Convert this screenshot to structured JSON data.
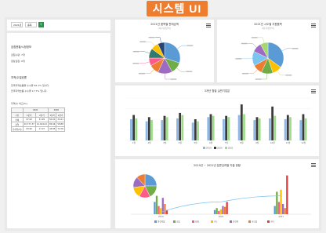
{
  "header": {
    "title": "시스템 UI"
  },
  "filters": {
    "year": "2021년",
    "type": "종목",
    "go_icon": "search-icon"
  },
  "stats": {
    "section1_title": "검침현황/시정정보",
    "line1": "검침수량: 7개",
    "line2": "정상검침: 0개",
    "section2_title": "지적/수질흐름",
    "line3": "전국지역흐름율 누수율 82.1% 입니다.",
    "line4": "전국지역흐름 누수율 17.7% 입니다.",
    "table_title": "지역/수 비교(%)",
    "table": {
      "top_headers": [
        "",
        "2021",
        "2020"
      ],
      "headers": [
        "구분",
        "1분기",
        "2분기",
        "1분기",
        "2분기"
      ],
      "rows": [
        [
          "전체",
          "67.02",
          "31.99",
          "50.01",
          "34.21"
        ],
        [
          "지역",
          "10,777.37",
          "12,344.01",
          "83.64",
          "58.88"
        ],
        [
          "전지역(비)",
          "63.62",
          "17.07",
          "44.85",
          "74.76"
        ]
      ]
    }
  },
  "chart_data": [
    {
      "type": "pie",
      "title": "2021년 품목별 판매금액",
      "subtitle": "4분기(전년비)",
      "slices": [
        {
          "value": 30,
          "color": "#5b9bd5"
        },
        {
          "value": 12,
          "color": "#70ad47"
        },
        {
          "value": 15,
          "color": "#9e6bc2"
        },
        {
          "value": 10,
          "color": "#ed7d31"
        },
        {
          "value": 8,
          "color": "#ff5b8a"
        },
        {
          "value": 10,
          "color": "#2f7c6f"
        },
        {
          "value": 8,
          "color": "#ffc000"
        },
        {
          "value": 7,
          "color": "#264478"
        }
      ]
    },
    {
      "type": "pie",
      "title": "2021년 시도별 지원품목",
      "subtitle": "4분기(전년비)",
      "slices": [
        {
          "value": 35,
          "color": "#5b9bd5"
        },
        {
          "value": 10,
          "color": "#ffc000"
        },
        {
          "value": 12,
          "color": "#70ad47"
        },
        {
          "value": 10,
          "color": "#ed7d31"
        },
        {
          "value": 15,
          "color": "#7cc4f0"
        },
        {
          "value": 10,
          "color": "#9e6bc2"
        },
        {
          "value": 8,
          "color": "#a5d86e"
        }
      ]
    },
    {
      "type": "bar",
      "title": "3개년 월별 실판기업분",
      "categories": [
        "1월",
        "2월",
        "3월",
        "4월",
        "5월",
        "6월",
        "7월",
        "8월",
        "9월",
        "10월",
        "11월",
        "12월"
      ],
      "ylim": [
        0,
        100
      ],
      "series": [
        {
          "name": "2019",
          "color": "#8fb8e6",
          "values": [
            50,
            45,
            48,
            52,
            42,
            55,
            50,
            60,
            48,
            52,
            50,
            48
          ]
        },
        {
          "name": "2020",
          "color": "#3b3b3b",
          "values": [
            60,
            55,
            58,
            65,
            50,
            62,
            58,
            85,
            55,
            80,
            60,
            62
          ]
        },
        {
          "name": "2021",
          "color": "#9fdc8a",
          "values": [
            52,
            48,
            55,
            60,
            45,
            58,
            55,
            62,
            52,
            58,
            55,
            52
          ]
        }
      ]
    },
    {
      "type": "bar",
      "title": "2019년 ~ 2021년 분류입력별 지출 현황",
      "categories": [
        "2019",
        "2020",
        "2021"
      ],
      "ylim": [
        0,
        100
      ],
      "series": [
        {
          "name": "물류비용",
          "color": "#5b9bd5",
          "values": [
            30,
            10,
            20
          ]
        },
        {
          "name": "교통",
          "color": "#70ad47",
          "values": [
            45,
            15,
            55
          ]
        },
        {
          "name": "자재",
          "color": "#ff5b8a",
          "values": [
            20,
            8,
            30
          ]
        },
        {
          "name": "수도",
          "color": "#ffc000",
          "values": [
            15,
            12,
            60
          ]
        },
        {
          "name": "인건비",
          "color": "#9e6bc2",
          "values": [
            40,
            20,
            25
          ]
        },
        {
          "name": "소모품",
          "color": "#ed7d31",
          "values": [
            25,
            18,
            15
          ]
        },
        {
          "name": "기타",
          "color": "#e23b3b",
          "values": [
            10,
            30,
            95
          ]
        }
      ],
      "line": {
        "color": "#7cc4f0",
        "values": [
          5,
          30,
          45
        ]
      },
      "pie": [
        {
          "value": 25,
          "color": "#5b9bd5"
        },
        {
          "value": 18,
          "color": "#70ad47"
        },
        {
          "value": 15,
          "color": "#ff5b8a"
        },
        {
          "value": 15,
          "color": "#ffc000"
        },
        {
          "value": 15,
          "color": "#9e6bc2"
        },
        {
          "value": 12,
          "color": "#ed7d31"
        }
      ]
    }
  ]
}
